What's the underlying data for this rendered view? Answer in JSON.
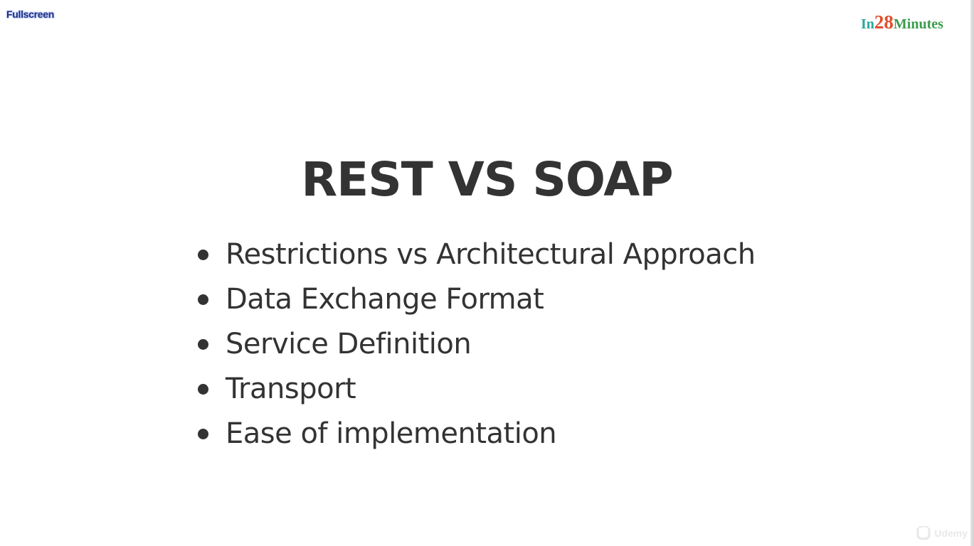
{
  "toolbar": {
    "fullscreen_label": "Fullscreen"
  },
  "logo": {
    "part_a": "In",
    "part_b": "28",
    "part_c": "Minutes",
    "colors": {
      "part_a": "#2aa79b",
      "part_b": "#e24d2b",
      "part_c": "#3a9c4c"
    }
  },
  "slide": {
    "title": "REST VS SOAP",
    "bullets": [
      {
        "label": "Restrictions vs Architectural Approach"
      },
      {
        "label": "Data Exchange Format"
      },
      {
        "label": "Service Definition"
      },
      {
        "label": "Transport"
      },
      {
        "label": "Ease of implementation"
      }
    ],
    "text_color": "#333333"
  },
  "watermark": {
    "icon": "udemy-logo-icon",
    "label": "Udemy"
  }
}
